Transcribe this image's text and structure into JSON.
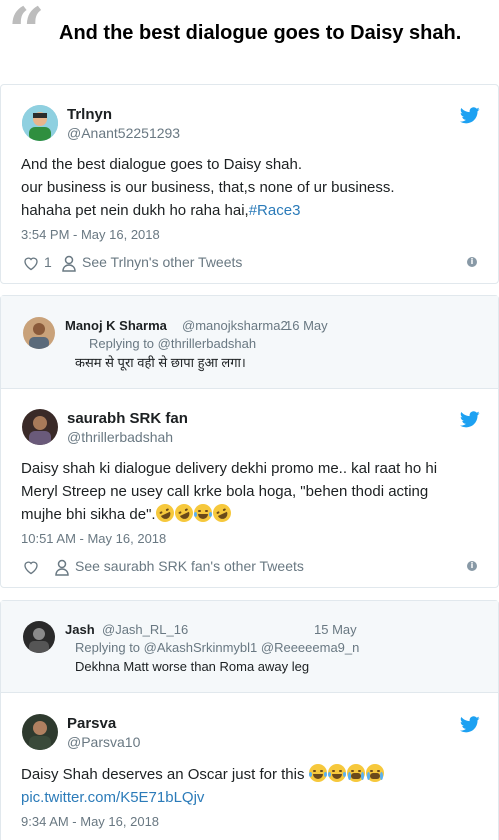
{
  "header": {
    "quote_mark": "“",
    "title": "And the best dialogue goes to Daisy shah."
  },
  "colors": {
    "twitter_blue": "#1da1f2",
    "link": "#2b7bb9",
    "muted": "#697882"
  },
  "tweet1": {
    "name": "Trlnyn",
    "handle": "@Anant52251293",
    "lines": [
      "And the best dialogue goes to Daisy shah.",
      "our business is our business, that,s none of ur business."
    ],
    "line3_text": "hahaha pet nein dukh ho raha hai,",
    "hashtag": "#Race3",
    "time": "3:54 PM - May 16, 2018",
    "likes": "1",
    "other_tweets": "See Trlnyn's other Tweets"
  },
  "reply1": {
    "name": "Manoj K Sharma",
    "handle": "@manojksharma2",
    "date": "16 May",
    "replying": "Replying to @thrillerbadshah",
    "text": "कसम से पूरा वही से छापा हुआ लगा।"
  },
  "tweet2": {
    "name": "saurabh SRK fan",
    "handle": "@thrillerbadshah",
    "lines": [
      "Daisy shah ki dialogue delivery dekhi promo me.. kal raat ho hi",
      "Meryl Streep ne usey call krke bola hoga, \"behen thodi acting"
    ],
    "line3_text": "mujhe bhi sikha de\".",
    "time": "10:51 AM - May 16, 2018",
    "other_tweets": "See saurabh SRK fan's other Tweets"
  },
  "reply2": {
    "name": "Jash",
    "handle": "@Jash_RL_16",
    "date": "15 May",
    "replying": "Replying to @AkashSrkinmybl1 @Reeeeema9_n",
    "text": "Dekhna Matt worse than Roma away leg"
  },
  "tweet3": {
    "name": "Parsva",
    "handle": "@Parsva10",
    "line1_text": "Daisy Shah deserves an Oscar just for this",
    "link": "pic.twitter.com/K5E71bLQjv",
    "time": "9:34 AM - May 16, 2018"
  },
  "icons": [
    "twitter-bird-icon",
    "heart-icon",
    "person-icon",
    "info-icon"
  ]
}
